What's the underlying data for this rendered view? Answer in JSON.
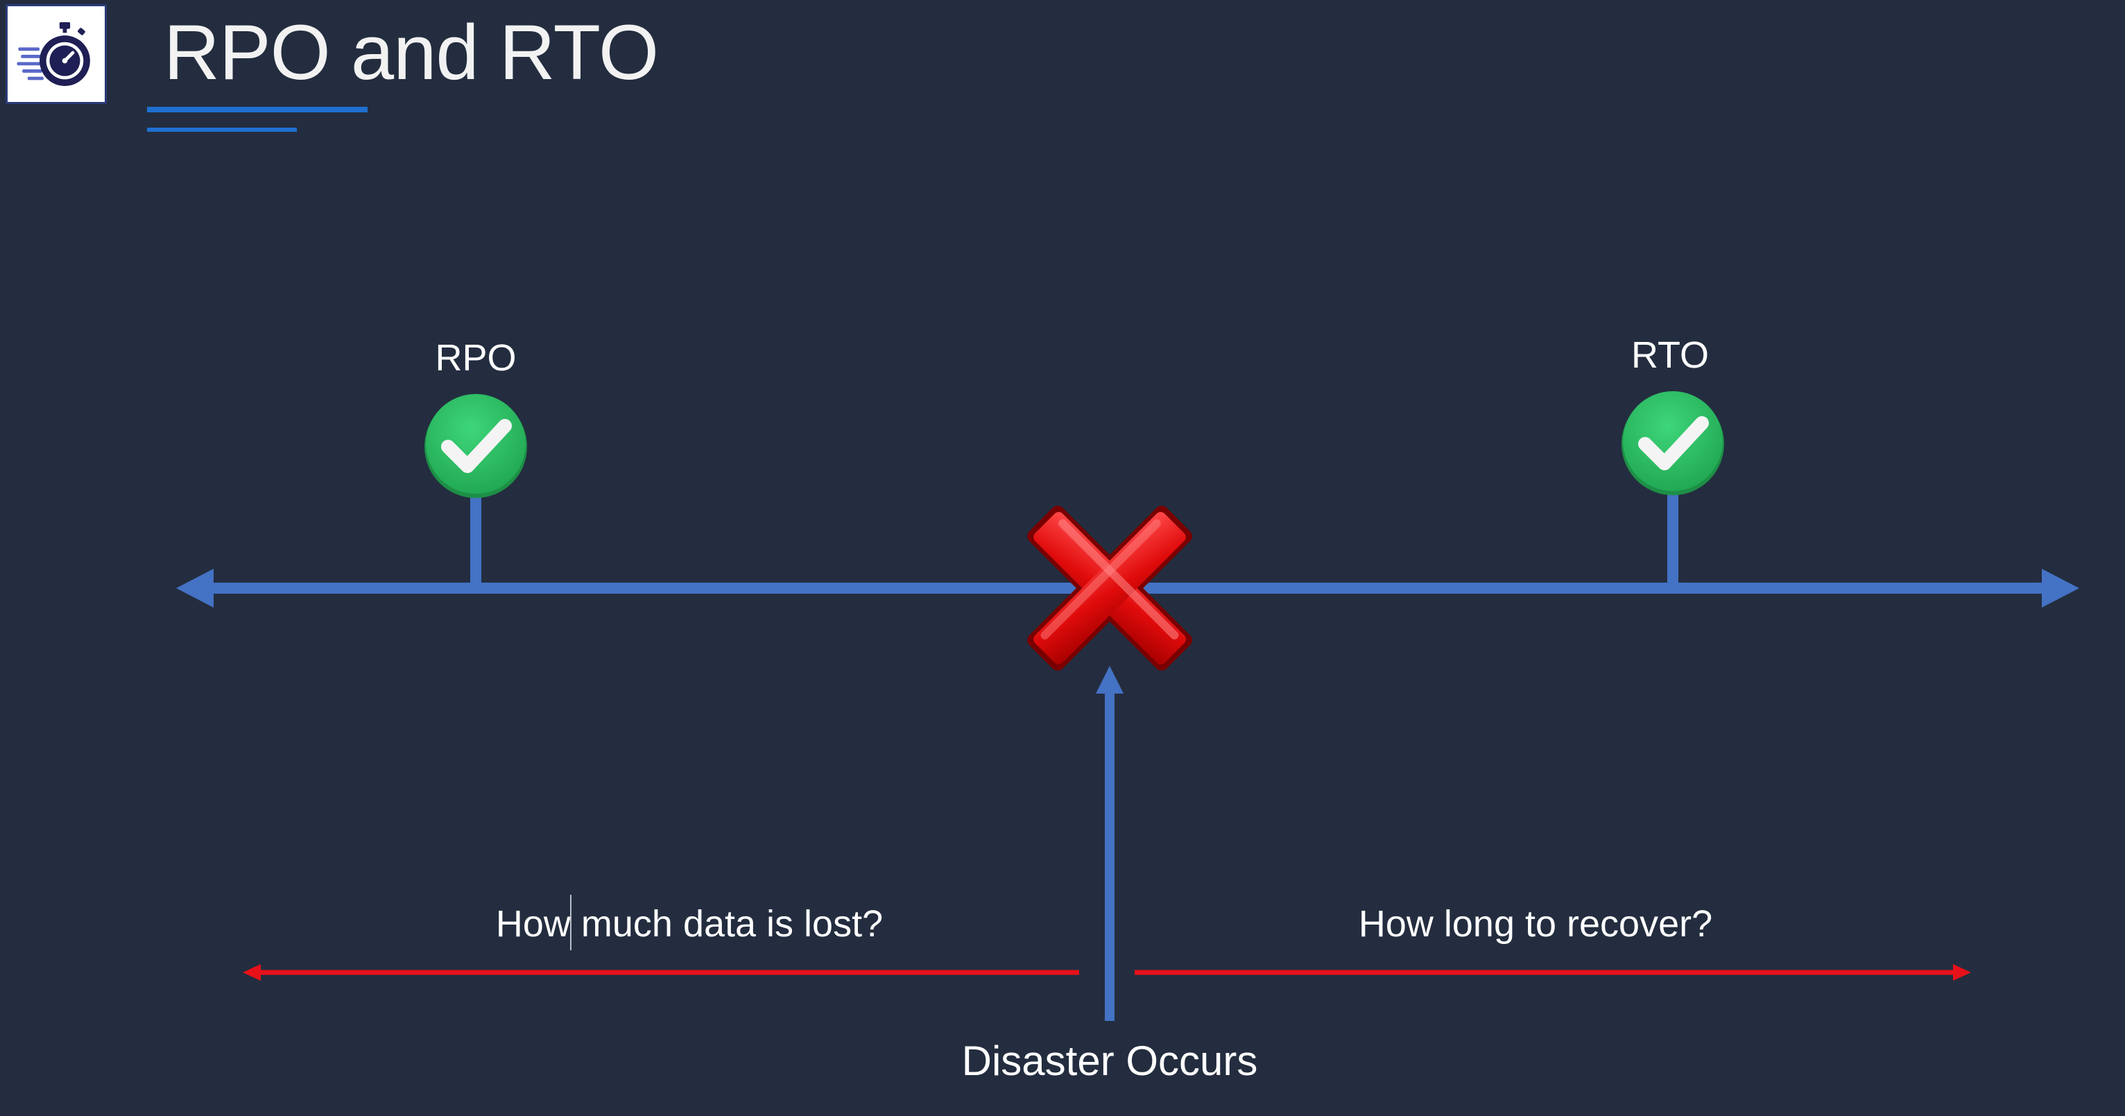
{
  "slide": {
    "title": "RPO and RTO",
    "background_color": "#232d3f",
    "accent_color": "#1f6fd1",
    "logo_icon": "stopwatch-speed-icon"
  },
  "timeline": {
    "line_color": "#4472c4",
    "left_marker": {
      "label": "RPO",
      "icon": "green-check-icon"
    },
    "right_marker": {
      "label": "RTO",
      "icon": "green-check-icon"
    },
    "event_icon": "red-x-icon",
    "event_label": "Disaster Occurs"
  },
  "spans": {
    "arrow_color": "#e8111a",
    "left_question": "How much data is lost?",
    "right_question": "How long to recover?"
  }
}
